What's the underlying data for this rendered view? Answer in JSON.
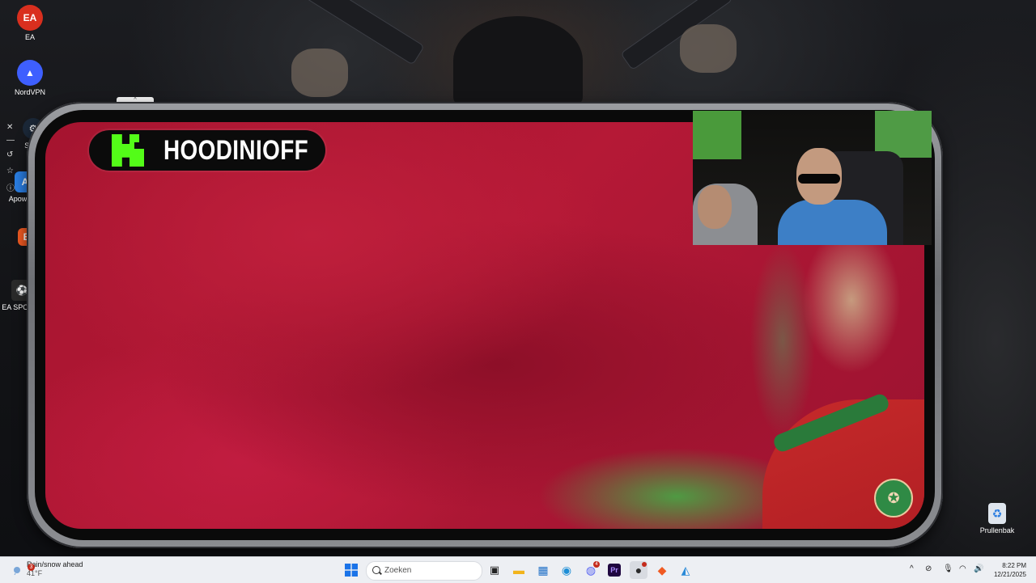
{
  "desktop": {
    "icons": [
      {
        "label": "EA",
        "icon": "ea-icon",
        "color": "#d92f1e",
        "glyph": "EA"
      },
      {
        "label": "NordVPN",
        "icon": "nordvpn-icon",
        "color": "#3e5fff",
        "glyph": "▲"
      },
      {
        "label": "Ste",
        "icon": "steam-icon",
        "color": "#1b2838",
        "glyph": "⚙"
      },
      {
        "label": "Apow",
        "icon": "apowersoft-icon",
        "color": "#2a7de1",
        "glyph": "A"
      },
      {
        "label": "B",
        "icon": "brave-icon",
        "color": "#f05a22",
        "glyph": "B"
      },
      {
        "label": "EA SPOR",
        "icon": "ea-sports-icon",
        "color": "#2a2a2a",
        "glyph": "⚽"
      }
    ],
    "recycle_bin": {
      "label": "Prullenbak",
      "icon": "recycle-bin-icon"
    }
  },
  "stream": {
    "channel_name": "HOODINIOFF",
    "platform_logo": "kick-logo",
    "accent_color": "#53fc18",
    "crest_glyph": "✪"
  },
  "taskbar": {
    "weather": {
      "text": "Rain/snow ahead",
      "temp": "41°F",
      "badge": "3"
    },
    "search_placeholder": "Zoeken",
    "pinned_apps": [
      {
        "name": "task-view-icon",
        "glyph": "▣",
        "color": "#222"
      },
      {
        "name": "file-explorer-icon",
        "glyph": "▬",
        "color": "#f2b41c"
      },
      {
        "name": "microsoft-store-icon",
        "glyph": "▦",
        "color": "#1f6fc7"
      },
      {
        "name": "edge-icon",
        "glyph": "◉",
        "color": "#1d8ed6"
      },
      {
        "name": "discord-icon",
        "glyph": "◍",
        "color": "#5865f2",
        "badge": "4"
      },
      {
        "name": "premiere-pro-icon",
        "glyph": "Pr",
        "color": "#1f0740"
      },
      {
        "name": "obs-icon",
        "glyph": "●",
        "color": "#2b2b2b",
        "badge": "•"
      },
      {
        "name": "brave-browser-icon",
        "glyph": "◆",
        "color": "#f05a22"
      },
      {
        "name": "app-icon",
        "glyph": "◭",
        "color": "#2a8ad8"
      }
    ],
    "tray": {
      "chevron": "^",
      "time": "8:22 PM",
      "date": "12/21/2025"
    }
  }
}
